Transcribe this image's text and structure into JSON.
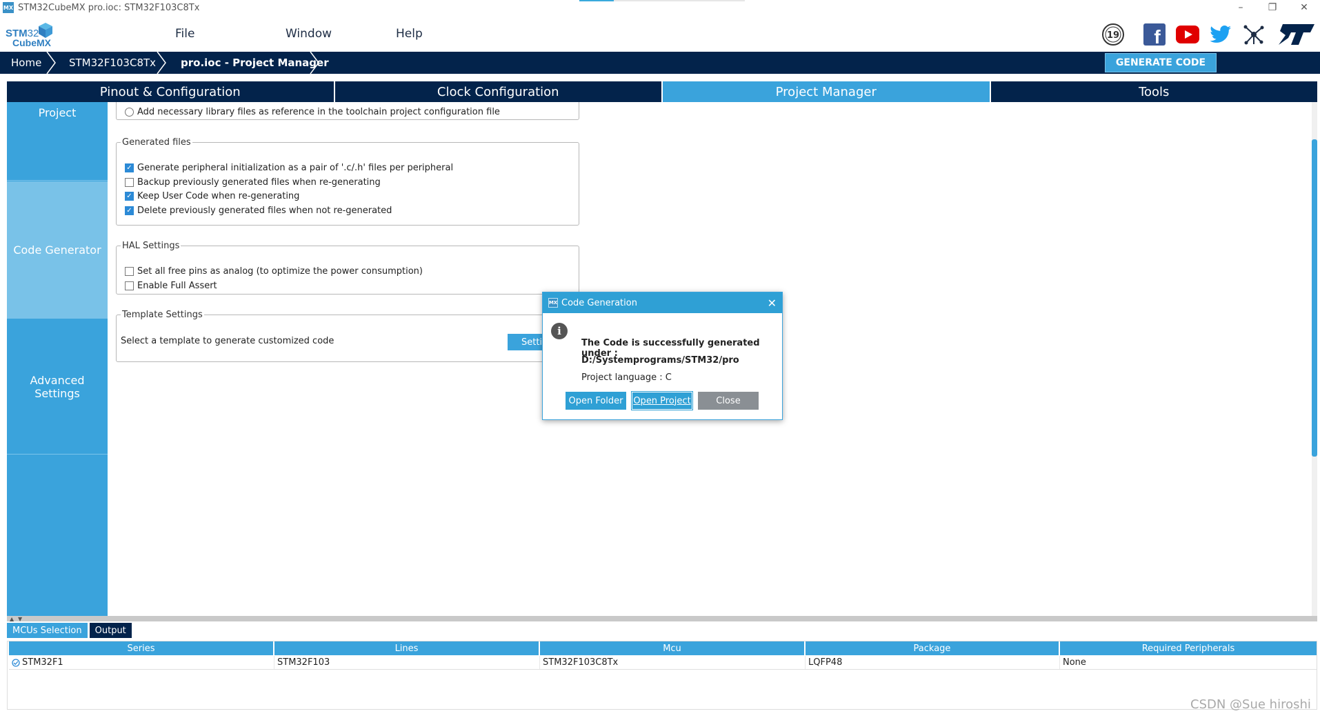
{
  "window": {
    "title": "STM32CubeMX pro.ioc: STM32F103C8Tx",
    "app_icon": "MX",
    "controls": {
      "minimize": "–",
      "restore": "❐",
      "close": "✕"
    }
  },
  "logo": {
    "line1_a": "STM",
    "line1_b": "32",
    "line2": "CubeMX"
  },
  "menu": {
    "file": "File",
    "window": "Window",
    "help": "Help"
  },
  "social": {
    "anniversary": "19",
    "facebook": "f",
    "youtube": "▶",
    "twitter": "🐦",
    "network": "✳",
    "st": "ST"
  },
  "breadcrumb": {
    "home": "Home",
    "mcu": "STM32F103C8Tx",
    "current": "pro.ioc - Project Manager"
  },
  "generate_code": "GENERATE CODE",
  "tabs": [
    "Pinout & Configuration",
    "Clock Configuration",
    "Project Manager",
    "Tools"
  ],
  "sidebar": [
    "Project",
    "Code Generator",
    "Advanced Settings"
  ],
  "library_option": "Add necessary library files as reference in the toolchain project configuration file",
  "generated_files": {
    "legend": "Generated files",
    "options": [
      {
        "label": "Generate peripheral initialization as a pair of '.c/.h' files per peripheral",
        "checked": true
      },
      {
        "label": "Backup previously generated files when re-generating",
        "checked": false
      },
      {
        "label": "Keep User Code when re-generating",
        "checked": true
      },
      {
        "label": "Delete previously generated files when not re-generated",
        "checked": true
      }
    ]
  },
  "hal_settings": {
    "legend": "HAL Settings",
    "options": [
      {
        "label": "Set all free pins as analog (to optimize the power consumption)",
        "checked": false
      },
      {
        "label": "Enable Full Assert",
        "checked": false
      }
    ]
  },
  "template_settings": {
    "legend": "Template Settings",
    "text": "Select a template to generate customized code",
    "button": "Settings..."
  },
  "bottom_tabs": {
    "mcus": "MCUs Selection",
    "output": "Output"
  },
  "table": {
    "headers": [
      "Series",
      "Lines",
      "Mcu",
      "Package",
      "Required Peripherals"
    ],
    "rows": [
      [
        "STM32F1",
        "STM32F103",
        "STM32F103C8Tx",
        "LQFP48",
        "None"
      ]
    ]
  },
  "dialog": {
    "title": "Code Generation",
    "message": "The Code is successfully generated under :",
    "path": "D:/Systemprograms/STM32/pro",
    "language": "Project language : C",
    "buttons": {
      "open_folder": "Open Folder",
      "open_project": "Open Project",
      "close": "Close"
    }
  },
  "watermark": "CSDN @Sue hiroshi",
  "colors": {
    "navy": "#03234b",
    "accent": "#3aa3dc",
    "sidebar_active": "#79c2e8"
  }
}
